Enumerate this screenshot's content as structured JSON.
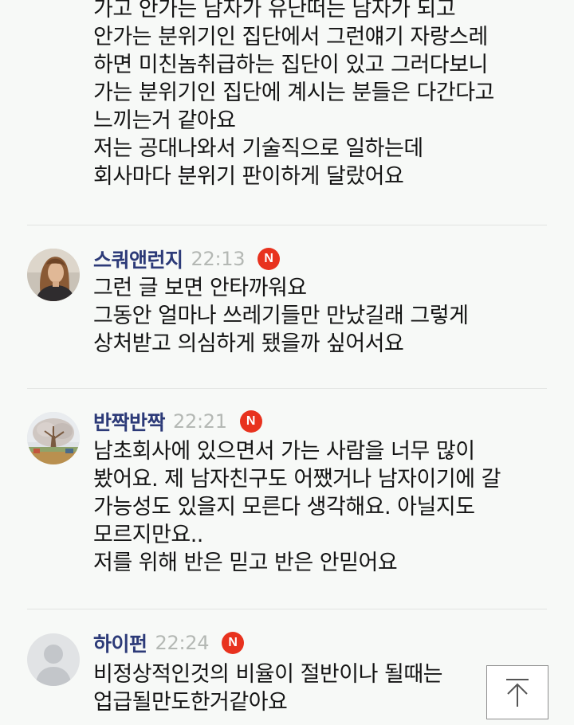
{
  "comments": [
    {
      "partial": true,
      "lines": [
        "가고 안가는 남자가 유난떠는 남자가 되고",
        "안가는 분위기인 집단에서 그런얘기 자랑스레",
        "하면 미친놈취급하는 집단이 있고 그러다보니",
        "가는 분위기인 집단에 계시는 분들은 다간다고",
        "느끼는거 같아요",
        "저는 공대나와서 기술직으로 일하는데",
        "회사마다 분위기 판이하게 달랐어요"
      ]
    },
    {
      "nickname": "스쿼앤런지",
      "time": "22:13",
      "badge": "N",
      "avatar": "woman-portrait-avatar",
      "lines": [
        "그런 글 보면 안타까워요",
        "그동안 얼마나 쓰레기들만 만났길래 그렇게",
        "상처받고 의심하게 됐을까 싶어서요"
      ]
    },
    {
      "nickname": "반짝반짝",
      "time": "22:21",
      "badge": "N",
      "avatar": "tree-landscape-avatar",
      "lines": [
        "남초회사에 있으면서 가는 사람을 너무 많이",
        "봤어요. 제 남자친구도 어쨌거나 남자이기에 갈",
        "가능성도 있을지 모른다 생각해요. 아닐지도",
        "모르지만요..",
        "저를 위해 반은 믿고 반은 안믿어요"
      ]
    },
    {
      "nickname": "하이펀",
      "time": "22:24",
      "badge": "N",
      "avatar": "default-user-avatar",
      "lines": [
        "비정상적인것의 비율이 절반이나 될때는",
        "업급될만도한거같아요"
      ]
    }
  ],
  "scroll_top_button": {
    "icon": "arrow-up-to-top-icon"
  },
  "colors": {
    "background": "#f7f9f7",
    "nickname": "#2c3a78",
    "time": "#b4b8b4",
    "badge": "#e8321e",
    "text": "#141414",
    "divider": "#e2e4e2"
  }
}
